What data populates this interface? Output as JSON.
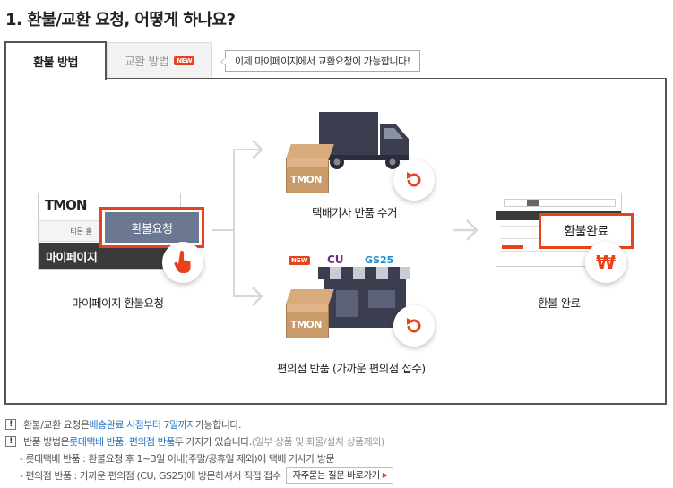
{
  "title": "1. 환불/교환 요청, 어떻게 하나요?",
  "tabs": {
    "refund": "환불 방법",
    "exchange": "교환 방법",
    "new_badge": "NEW"
  },
  "tooltip": "이제 마이페이지에서 교환요청이 가능합니다!",
  "step1": {
    "logo": "TMON",
    "home": "티몬 홈",
    "mypage": "마이페이지",
    "button": "환불요청",
    "label": "마이페이지 환불요청"
  },
  "step2a": {
    "box_logo": "TMON",
    "label": "택배기사 반품 수거"
  },
  "step2b": {
    "new_badge": "NEW",
    "store1": "CU",
    "store2": "GS25",
    "box_logo": "TMON",
    "label": "편의점 반품 (가까운 편의점 접수)"
  },
  "step3": {
    "button": "환불완료",
    "label": "환불 완료",
    "won": "₩"
  },
  "notes": {
    "n1_pre": "환불/교환 요청은 ",
    "n1_hl": "배송완료 시점부터 7일까지",
    "n1_post": " 가능합니다.",
    "n2_pre": "반품 방법은 ",
    "n2_hl": "롯데택배 반품, 편의점 반품",
    "n2_mid": " 두 가지가 있습니다. ",
    "n2_gray": "(일부 상품 및 화물/설치 상품제외)",
    "n3": "- 롯데택배 반품 : 환불요청 후 1~3일 이내(주말/공휴일 제외)에 택배 기사가 방문",
    "n4": "- 편의점 반품 : 가까운 편의점 (CU, GS25)에 방문하셔서 직접 접수",
    "faq": "자주묻는 질문 바로가기"
  },
  "colors": {
    "accent": "#e8421a",
    "highlight": "#2775c5",
    "button_bg": "#6c7891",
    "truck": "#3b3e4e"
  },
  "icons": {
    "return": "return-arrow-icon",
    "hand": "pointer-hand-icon",
    "won": "won-icon"
  }
}
